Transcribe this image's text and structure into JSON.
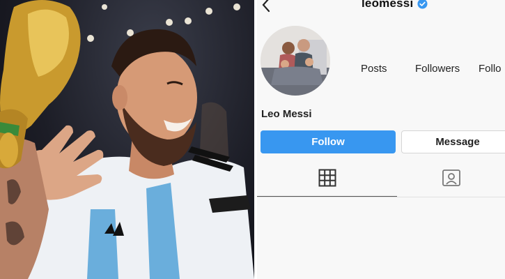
{
  "photo": {
    "subject": "Player celebrating with trophy"
  },
  "profile": {
    "username": "leomessi",
    "display_name": "Leo Messi",
    "stats": [
      {
        "label": "Posts"
      },
      {
        "label": "Followers"
      },
      {
        "label": "Follo"
      }
    ],
    "buttons": {
      "follow": "Follow",
      "message": "Message"
    },
    "tabs": [
      {
        "icon": "grid-icon",
        "active": true
      },
      {
        "icon": "tagged-icon",
        "active": false
      }
    ]
  },
  "colors": {
    "follow_button": "#3897f0",
    "verified_badge": "#3897f0",
    "panel_background": "#f8f8f8"
  }
}
